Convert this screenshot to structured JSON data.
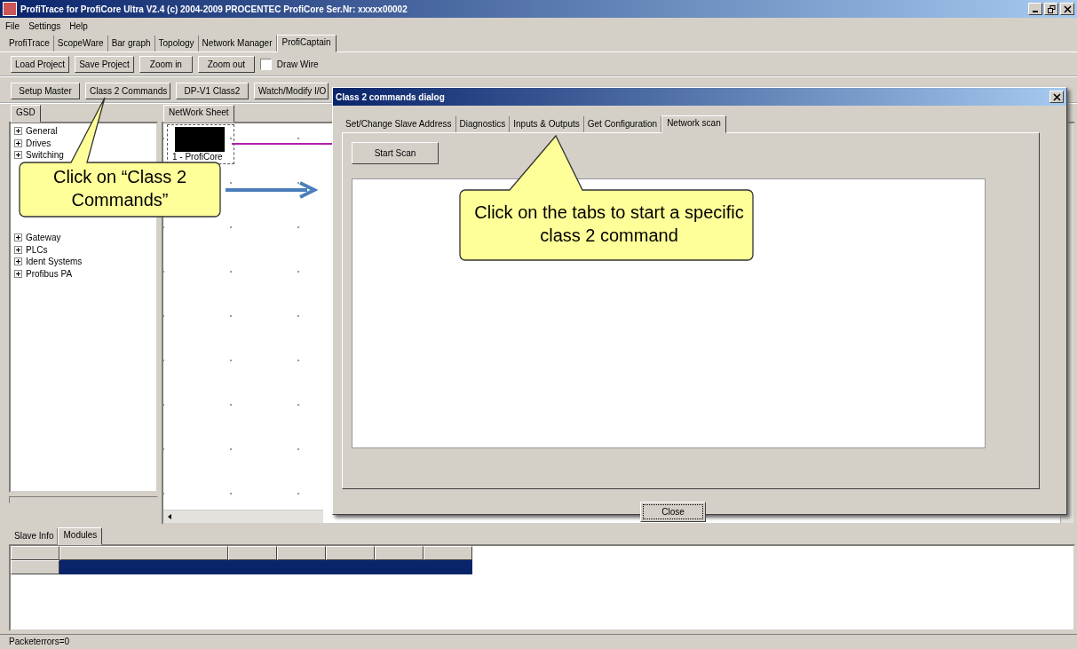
{
  "window": {
    "title": "ProfiTrace for ProfiCore Ultra V2.4 (c) 2004-2009 PROCENTEC  ProfiCore Ser.Nr: xxxxx00002"
  },
  "menu": [
    "File",
    "Settings",
    "Help"
  ],
  "tabs": [
    {
      "label": "ProfiTrace",
      "selected": false
    },
    {
      "label": "ScopeWare",
      "selected": false
    },
    {
      "label": "Bar graph",
      "selected": false
    },
    {
      "label": "Topology",
      "selected": false
    },
    {
      "label": "Network Manager",
      "selected": false
    },
    {
      "label": "ProfiCaptain",
      "selected": true
    }
  ],
  "toolbar": {
    "buttons": [
      "Load Project",
      "Save Project",
      "Zoom in",
      "Zoom out"
    ],
    "draw_wire": {
      "label": "Draw Wire",
      "checked": false
    }
  },
  "command_buttons": [
    "Setup Master",
    "Class 2 Commands",
    "DP-V1 Class2",
    "Watch/Modify I/O"
  ],
  "left_panel": {
    "tabs": [
      {
        "label": "GSD",
        "selected": true
      }
    ],
    "tree": [
      {
        "label": "General",
        "expanded": false
      },
      {
        "label": "Drives",
        "expanded": false
      },
      {
        "label": "Switching",
        "expanded": false
      },
      {
        "label": "Gateway",
        "expanded": false
      },
      {
        "label": "PLCs",
        "expanded": false
      },
      {
        "label": "Ident Systems",
        "expanded": false
      },
      {
        "label": "Profibus PA",
        "expanded": false
      }
    ]
  },
  "network_panel": {
    "tabs": [
      {
        "label": "NetWork Sheet",
        "selected": true
      }
    ],
    "device": {
      "label": "1 - ProfiCore"
    }
  },
  "dialog": {
    "title": "Class 2 commands dialog",
    "tabs": [
      {
        "label": "Set/Change Slave Address",
        "selected": false
      },
      {
        "label": "Diagnostics",
        "selected": false
      },
      {
        "label": "Inputs & Outputs",
        "selected": false
      },
      {
        "label": "Get Configuration",
        "selected": false
      },
      {
        "label": "Network scan",
        "selected": true
      }
    ],
    "start_button": "Start Scan",
    "close_button": "Close"
  },
  "bottom_panel": {
    "tabs": [
      {
        "label": "Slave Info",
        "selected": false
      },
      {
        "label": "Modules",
        "selected": true
      }
    ],
    "rows": [
      {
        "selected": true
      }
    ]
  },
  "status_bar": "Packeterrors=0",
  "callouts": [
    {
      "text": "Click on “Class 2 Commands”"
    },
    {
      "text": "Click on the tabs to start a specific class 2 command"
    }
  ]
}
